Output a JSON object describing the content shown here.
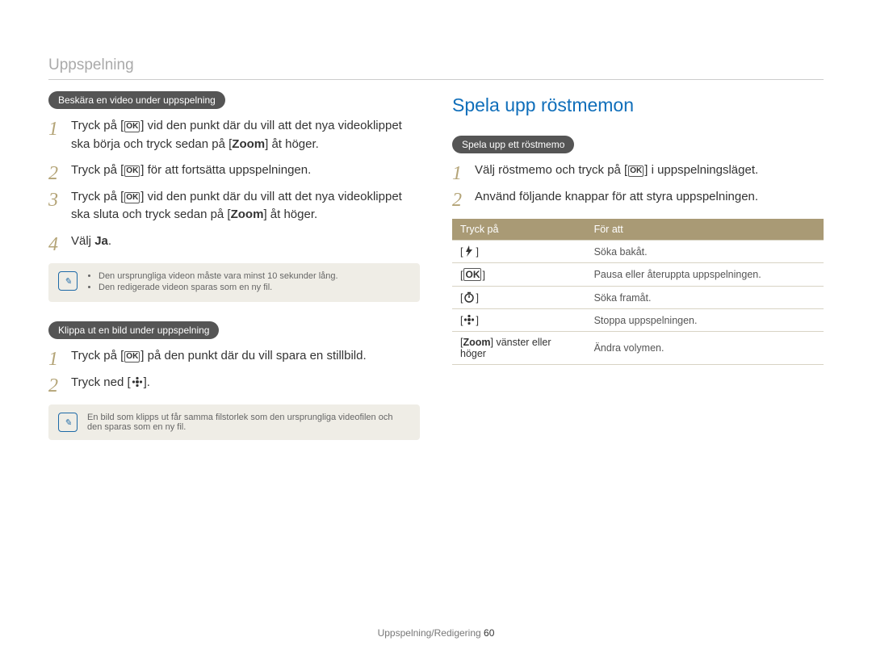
{
  "header": {
    "title": "Uppspelning"
  },
  "left": {
    "sectionA": {
      "pill": "Beskära en video under uppspelning",
      "steps": [
        {
          "pre1": "Tryck på [",
          "icon": "ok",
          "post1": "] vid den punkt där du vill att det nya videoklippet ska börja och tryck sedan på [",
          "bold1": "Zoom",
          "post2": "] åt höger."
        },
        {
          "pre1": "Tryck på [",
          "icon": "ok",
          "post1": "] för att fortsätta uppspelningen."
        },
        {
          "pre1": "Tryck på [",
          "icon": "ok",
          "post1": "] vid den punkt där du vill att det nya videoklippet ska sluta och tryck sedan på [",
          "bold1": "Zoom",
          "post2": "] åt höger."
        },
        {
          "pre1": "Välj ",
          "bold1": "Ja",
          "post1": "."
        }
      ],
      "note": {
        "items": [
          "Den ursprungliga videon måste vara minst 10 sekunder lång.",
          "Den redigerade videon sparas som en ny fil."
        ]
      }
    },
    "sectionB": {
      "pill": "Klippa ut en bild under uppspelning",
      "steps": [
        {
          "pre1": "Tryck på [",
          "icon": "ok",
          "post1": "] på den punkt där du vill spara en stillbild."
        },
        {
          "pre1": "Tryck ned [",
          "icon": "flower",
          "post1": "]."
        }
      ],
      "note_single": "En bild som klipps ut får samma filstorlek som den ursprungliga videofilen och den sparas som en ny fil."
    }
  },
  "right": {
    "title": "Spela upp röstmemon",
    "pill": "Spela upp ett röstmemo",
    "steps": [
      {
        "pre1": "Välj röstmemo och tryck på [",
        "icon": "ok",
        "post1": "] i uppspelningsläget."
      },
      {
        "plain": "Använd följande knappar för att styra uppspelningen."
      }
    ],
    "table": {
      "head": [
        "Tryck på",
        "För att"
      ],
      "rows": [
        {
          "icon": "flash",
          "desc": "Söka bakåt."
        },
        {
          "icon": "ok-box",
          "desc": "Pausa eller återuppta uppspelningen."
        },
        {
          "icon": "timer",
          "desc": "Söka framåt."
        },
        {
          "icon": "flower",
          "desc": "Stoppa uppspelningen."
        },
        {
          "text_pre": "[",
          "bold": "Zoom",
          "text_post": "] vänster eller höger",
          "desc": "Ändra volymen."
        }
      ]
    }
  },
  "footer": {
    "label": "Uppspelning/Redigering",
    "page": "60"
  },
  "glyphs": {
    "ok_label": "OK",
    "note_label": "✎"
  }
}
